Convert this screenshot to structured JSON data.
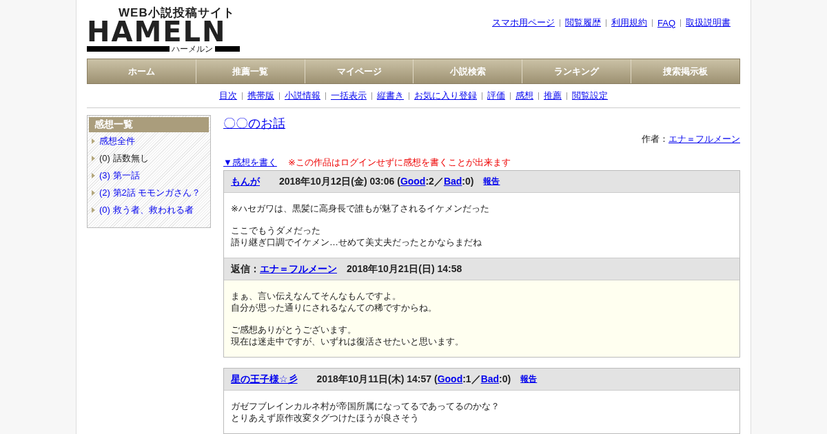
{
  "logo": {
    "tagline": "WEB小説投稿サイト",
    "wordmark": "HAMELN",
    "reading": "ハーメルン"
  },
  "top_links": [
    "スマホ用ページ",
    "閲覧履歴",
    "利用規約",
    "FAQ",
    "取扱説明書"
  ],
  "nav": [
    "ホーム",
    "推薦一覧",
    "マイページ",
    "小説検索",
    "ランキング",
    "捜索掲示板"
  ],
  "sub_links": [
    "目次",
    "携帯版",
    "小説情報",
    "一括表示",
    "縦書き",
    "お気に入り登録",
    "評価",
    "感想",
    "推薦",
    "閲覧設定"
  ],
  "sidebar": {
    "title": "感想一覧",
    "items": [
      {
        "label": "感想全件",
        "link": true
      },
      {
        "label": "(0) 話数無し",
        "link": false
      },
      {
        "label": "(3) 第一話",
        "link": true
      },
      {
        "label": "(2) 第2話 モモンガさん？",
        "link": true
      },
      {
        "label": "(0) 救う者、救われる者",
        "link": true
      }
    ]
  },
  "story": {
    "title": "〇〇のお話",
    "author_label": "作者：",
    "author": "エナ＝フルメーン"
  },
  "write_link": "▼感想を書く",
  "notice": "※この作品はログインせずに感想を書くことが出来ます",
  "comments": [
    {
      "name": "もんが",
      "meta": [
        {
          "kind": "text",
          "text": "2018年10月12日(金) 03:06 ("
        },
        {
          "kind": "link",
          "text": "Good"
        },
        {
          "kind": "text",
          "text": ":2／"
        },
        {
          "kind": "link",
          "text": "Bad"
        },
        {
          "kind": "text",
          "text": ":0)"
        }
      ],
      "report": "報告",
      "body": [
        [
          "※ハセガワは、黒髪に高身長で誰もが魅了されるイケメンだった"
        ],
        [
          "ここでもうダメだった",
          "語り継ぎ口調でイケメン…せめて美丈夫だったとかならまだね"
        ]
      ],
      "reply": {
        "label": "返信：",
        "author": "エナ＝フルメーン",
        "date": "2018年10月21日(日) 14:58",
        "body": [
          [
            "まぁ、言い伝えなんてそんなもんですよ。",
            "自分が思った通りにされるなんての稀ですからね。"
          ],
          [
            "ご感想ありがとうございます。",
            "現在は迷走中ですが、いずれは復活させたいと思います。"
          ]
        ]
      }
    },
    {
      "name": "星の王子様☆彡",
      "meta": [
        {
          "kind": "text",
          "text": "2018年10月11日(木) 14:57 ("
        },
        {
          "kind": "link",
          "text": "Good"
        },
        {
          "kind": "text",
          "text": ":1／"
        },
        {
          "kind": "link",
          "text": "Bad"
        },
        {
          "kind": "text",
          "text": ":0)"
        }
      ],
      "report": "報告",
      "body": [
        [
          "ガゼフブレインカルネ村が帝国所属になってるであってるのかな？",
          "とりあえず原作改変タグつけたほうが良さそう"
        ]
      ]
    }
  ]
}
